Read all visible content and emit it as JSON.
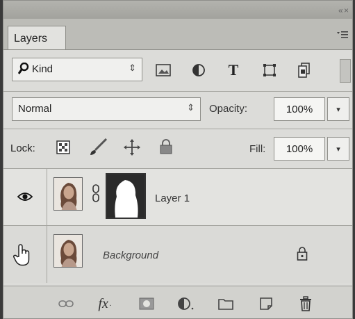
{
  "panel": {
    "tab_label": "Layers",
    "title_controls": "« ×",
    "menu_icon": "panel-menu-icon"
  },
  "filter": {
    "kind_label": "Kind",
    "icons": [
      "image-filter-icon",
      "adjustment-filter-icon",
      "type-filter-icon",
      "shape-filter-icon",
      "smart-object-filter-icon"
    ],
    "type_glyph": "T"
  },
  "blend": {
    "mode": "Normal",
    "opacity_label": "Opacity:",
    "opacity_value": "100%"
  },
  "lock": {
    "label": "Lock:",
    "fill_label": "Fill:",
    "fill_value": "100%"
  },
  "layers": [
    {
      "name": "Layer 1",
      "visible": true,
      "has_mask": true,
      "linked": true
    },
    {
      "name": "Background",
      "visible": false,
      "locked": true
    }
  ],
  "footer": {
    "fx_label": "fx",
    "icons": [
      "link-layers-icon",
      "fx-icon",
      "add-mask-icon",
      "adjustment-layer-icon",
      "group-folder-icon",
      "new-layer-icon",
      "delete-layer-icon"
    ]
  },
  "colors": {
    "panel_bg": "#dcdcd9",
    "titlebar": "#a9a9a4",
    "field_bg": "#f0f0ee"
  }
}
